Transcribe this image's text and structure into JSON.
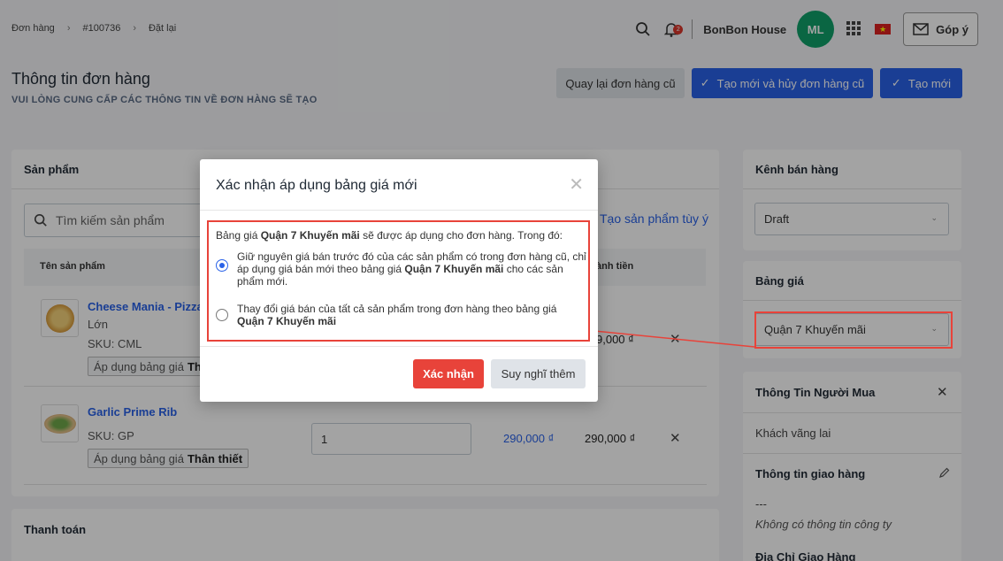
{
  "breadcrumb": [
    "Đơn hàng",
    "#100736",
    "Đặt lại"
  ],
  "header": {
    "notification_count": "2",
    "shop_name": "BonBon House",
    "avatar_initials": "ML",
    "feedback_label": "Góp ý",
    "flag_star": "★"
  },
  "page": {
    "title": "Thông tin đơn hàng",
    "subtitle": "VUI LÒNG CUNG CẤP CÁC THÔNG TIN VỀ ĐƠN HÀNG SẼ TẠO",
    "back_label": "Quay lại đơn hàng cũ",
    "cancel_new_label": "Tạo mới và hủy đơn hàng cũ",
    "new_label": "Tạo mới"
  },
  "products": {
    "title": "Sản phẩm",
    "search_placeholder": "Tìm kiếm sản phẩm",
    "custom_link": "Tạo sản phẩm tùy ý",
    "col_name": "Tên sản phẩm",
    "col_amount": "ành tiền",
    "items": [
      {
        "name": "Cheese Mania - Pizza",
        "variant": "Lớn",
        "sku": "SKU: CML",
        "tag_prefix": "Áp dụng bảng giá",
        "tag_value": "Thâ",
        "amount": "9,000 ₫"
      },
      {
        "name": "Garlic Prime Rib",
        "sku": "SKU: GP",
        "tag_prefix": "Áp dụng bảng giá",
        "tag_value": "Thân thiết",
        "quantity": "1",
        "price": "290,000 ₫",
        "amount": "290,000 ₫"
      }
    ]
  },
  "payment": {
    "title": "Thanh toán"
  },
  "sidebar": {
    "channel_title": "Kênh bán hàng",
    "channel_value": "Draft",
    "pricelist_title": "Bảng giá",
    "pricelist_value": "Quận 7 Khuyến mãi",
    "buyer_title": "Thông Tin Người Mua",
    "buyer_value": "Khách vãng lai",
    "shipping_title": "Thông tin giao hàng",
    "shipping_dash": "---",
    "shipping_company": "Không có thông tin công ty",
    "address_title": "Địa Chỉ Giao Hàng"
  },
  "modal": {
    "title": "Xác nhận áp dụng bảng giá mới",
    "intro_prefix": "Bảng giá",
    "intro_name": "Quận 7 Khuyến mãi",
    "intro_suffix": "sẽ được áp dụng cho đơn hàng. Trong đó:",
    "option1_a": "Giữ nguyên giá bán trước đó của các sản phẩm có trong đơn hàng cũ, chỉ áp dụng giá bán mới theo bảng giá",
    "option1_name": "Quận 7 Khuyến mãi",
    "option1_b": "cho các sản phẩm mới.",
    "option2_a": "Thay đổi giá bán của tất cả sản phẩm trong đơn hàng theo bảng giá",
    "option2_name": "Quận 7 Khuyến mãi",
    "confirm_label": "Xác nhận",
    "think_label": "Suy nghĩ thêm",
    "selected_option": 1
  },
  "colors": {
    "primary": "#2962e8",
    "danger": "#e8433a",
    "avatar": "#10a06a"
  }
}
